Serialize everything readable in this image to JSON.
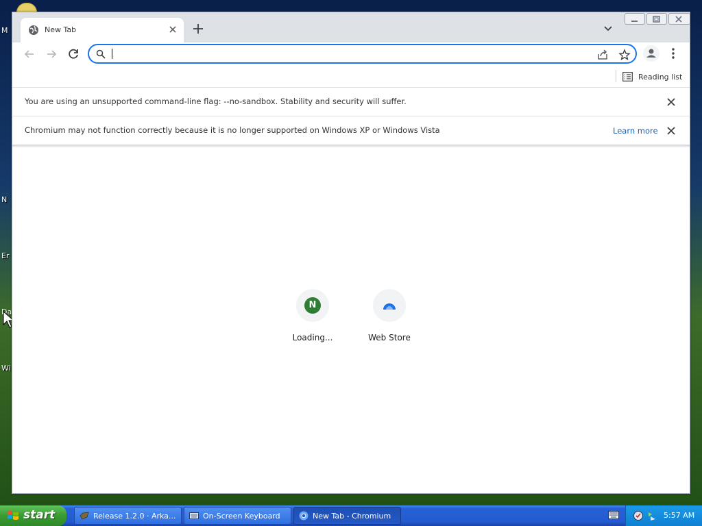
{
  "desktop": {
    "icon_labels": [
      "M",
      "N",
      "Er",
      "Da",
      "Wi"
    ]
  },
  "browser": {
    "tab": {
      "title": "New Tab"
    },
    "toolbar": {
      "omnibox_value": ""
    },
    "bookmarks": {
      "reading_list_label": "Reading list"
    },
    "infobars": [
      {
        "message": "You are using an unsupported command-line flag: --no-sandbox. Stability and security will suffer."
      },
      {
        "message": "Chromium may not function correctly because it is no longer supported on Windows XP or Windows Vista",
        "link": "Learn more"
      }
    ],
    "shortcuts": [
      {
        "label": "Loading...",
        "badge": "N",
        "badge_color": "#2e7d32"
      },
      {
        "label": "Web Store"
      }
    ],
    "accent_color": "#1a73e8"
  },
  "taskbar": {
    "start_label": "start",
    "buttons": [
      {
        "label": "Release 1.2.0 · Arka...",
        "icon": "app-icon",
        "active": false
      },
      {
        "label": "On-Screen Keyboard",
        "icon": "keyboard-icon",
        "active": false
      },
      {
        "label": "New Tab - Chromium",
        "icon": "chromium-icon",
        "active": true
      }
    ],
    "clock": "5:57 AM"
  }
}
